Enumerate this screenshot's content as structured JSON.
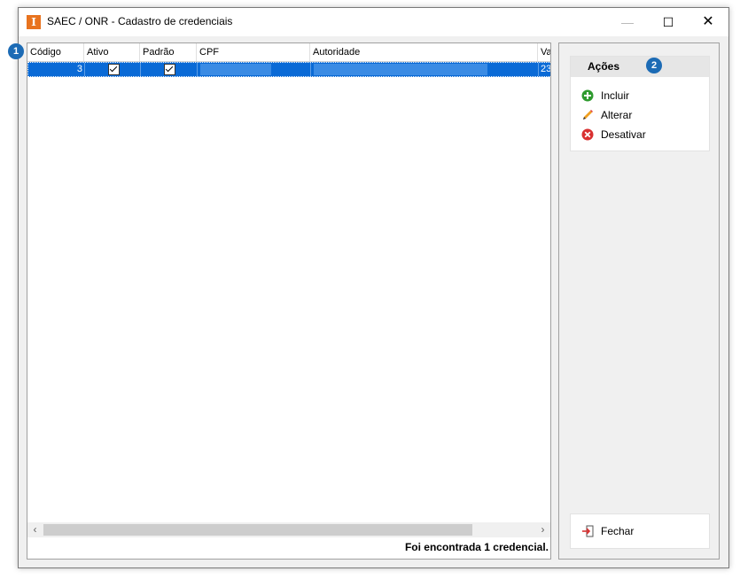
{
  "window": {
    "title": "SAEC / ONR - Cadastro de credenciais",
    "icon_letter": "I",
    "minimize": "—",
    "maximize": "☐",
    "close": "✕"
  },
  "grid": {
    "columns": [
      "Código",
      "Ativo",
      "Padrão",
      "CPF",
      "Autoridade",
      "Va"
    ],
    "rows": [
      {
        "codigo": "3",
        "ativo": true,
        "padrao": true,
        "cpf": "",
        "autoridade": "",
        "va": "23"
      }
    ],
    "status": "Foi encontrada 1 credencial."
  },
  "scroll": {
    "left": "‹",
    "right": "›"
  },
  "badges": {
    "grid": "1",
    "actions": "2"
  },
  "actions": {
    "title": "Ações",
    "items": [
      {
        "label": "Incluir",
        "icon": "add-icon"
      },
      {
        "label": "Alterar",
        "icon": "pencil-icon"
      },
      {
        "label": "Desativar",
        "icon": "remove-icon"
      }
    ]
  },
  "fechar": {
    "label": "Fechar",
    "icon": "exit-icon"
  },
  "colors": {
    "selection": "#0a6ad6",
    "accent": "#e8731f",
    "badge": "#1c6bb5"
  }
}
